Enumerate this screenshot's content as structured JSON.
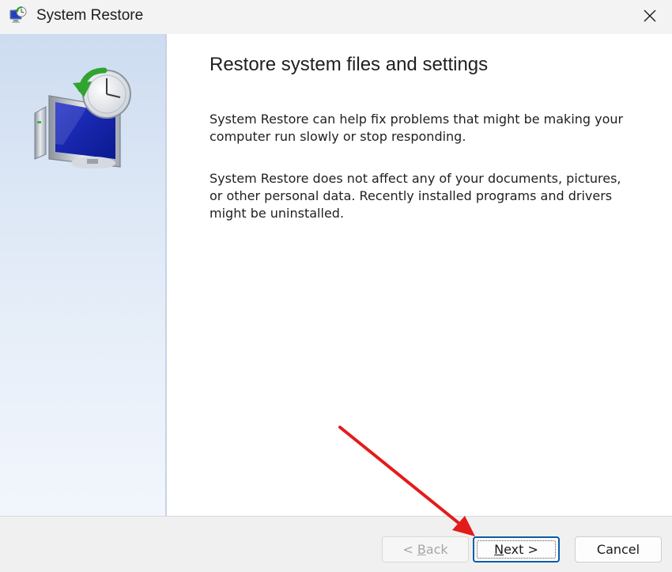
{
  "window": {
    "title": "System Restore",
    "app_icon": "system-restore-icon",
    "close_icon": "close-icon"
  },
  "banner": {
    "icon": "monitor-clock-restore-icon"
  },
  "content": {
    "heading": "Restore system files and settings",
    "paragraph1": "System Restore can help fix problems that might be making your computer run slowly or stop responding.",
    "paragraph2": "System Restore does not affect any of your documents, pictures, or other personal data. Recently installed programs and drivers might be uninstalled."
  },
  "footer": {
    "back": {
      "prefix": "< ",
      "mnemonic": "B",
      "rest": "ack",
      "enabled": false
    },
    "next": {
      "mnemonic": "N",
      "rest": "ext >",
      "enabled": true,
      "focused": true
    },
    "cancel": {
      "label": "Cancel"
    }
  },
  "annotation": {
    "type": "arrow",
    "color": "#e41b1b",
    "points_to": "next-button"
  },
  "colors": {
    "accent_border": "#0b5cad",
    "banner_top": "#cddcf0",
    "banner_bottom": "#f2f6fc"
  }
}
